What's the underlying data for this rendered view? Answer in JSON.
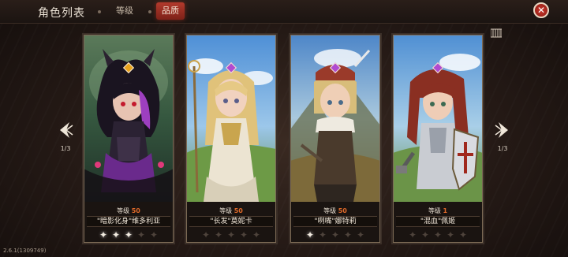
{
  "header": {
    "title": "角色列表",
    "tabs": [
      {
        "label": "等级",
        "active": false
      },
      {
        "label": "品质",
        "active": true
      }
    ]
  },
  "nav": {
    "left_page": "1/3",
    "right_page": "1/3"
  },
  "cards": [
    {
      "level_label": "等级",
      "level_value": "50",
      "name": "\"暗影化身\"维多利亚",
      "stars_on": 3,
      "stars_total": 5,
      "gem_color": "#e8a21c"
    },
    {
      "level_label": "等级",
      "level_value": "50",
      "name": "\"长发\"莫妮卡",
      "stars_on": 0,
      "stars_total": 5,
      "gem_color": "#b04ad0"
    },
    {
      "level_label": "等级",
      "level_value": "50",
      "name": "\"咧嘴\"娜特莉",
      "stars_on": 1,
      "stars_total": 5,
      "gem_color": "#b04ad0"
    },
    {
      "level_label": "等级",
      "level_value": "1",
      "name": "\"混血\"佩姬",
      "stars_on": 0,
      "stars_total": 5,
      "gem_color": "#b04ad0"
    }
  ],
  "footer": {
    "version": "2.6.1(1309749)"
  },
  "colors": {
    "accent_red": "#b23a2c",
    "level_value": "#e06a2a"
  },
  "icons": [
    "close-icon",
    "filter-icon",
    "arrow-left-icon",
    "arrow-right-icon",
    "star-icon"
  ]
}
